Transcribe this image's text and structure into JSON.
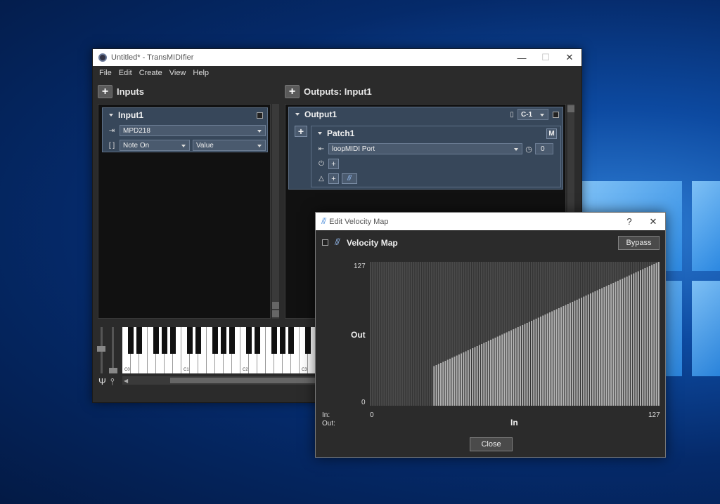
{
  "main_window": {
    "title": "Untitled* - TransMIDIfier",
    "controls": {
      "minimize": "—",
      "maximize": "☐",
      "close": "✕"
    }
  },
  "menu": [
    "File",
    "Edit",
    "Create",
    "View",
    "Help"
  ],
  "inputs": {
    "header": "Inputs",
    "card": {
      "title": "Input1",
      "device": "MPD218",
      "type": "Note On",
      "param": "Value"
    }
  },
  "outputs": {
    "header": "Outputs: Input1",
    "card": {
      "title": "Output1",
      "channel": "C-1",
      "patch": {
        "title": "Patch1",
        "m_label": "M",
        "port": "loopMIDI Port",
        "delay": "0"
      }
    }
  },
  "piano": {
    "labels": [
      "C0",
      "C1",
      "C2",
      "C3"
    ]
  },
  "dialog": {
    "title": "Edit Velocity Map",
    "help": "?",
    "close_x": "✕",
    "heading": "Velocity Map",
    "bypass": "Bypass",
    "close": "Close",
    "in_label": "In:",
    "out_label": "Out:"
  },
  "chart_data": {
    "type": "bar",
    "xlabel": "In",
    "ylabel": "Out",
    "xlim": [
      0,
      127
    ],
    "ylim": [
      0,
      127
    ],
    "x_ticks": [
      "0",
      "127"
    ],
    "y_ticks": [
      "127",
      "0"
    ],
    "mapping": {
      "x_start": 28,
      "y_start": 35,
      "x_end": 127,
      "y_end": 127
    },
    "bar_color": "#b3b3b3",
    "track_color": "#4a4a4a"
  },
  "colors": {
    "card_bg": "#37475a",
    "panel_bg": "#111111",
    "window_bg": "#2b2b2b"
  }
}
